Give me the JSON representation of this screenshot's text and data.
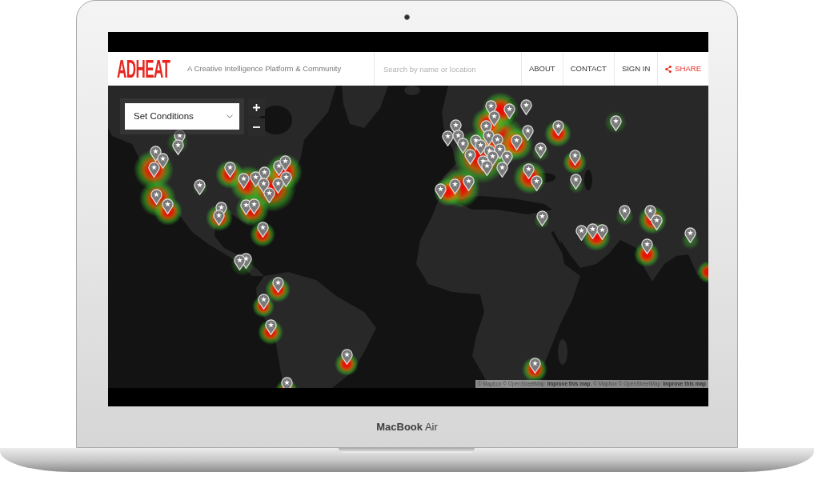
{
  "device": {
    "label": "**MacBook** Air"
  },
  "header": {
    "logo": "ADHEAT",
    "tagline": "A Creative Intelligence Platform & Community",
    "search": {
      "placeholder": "Search by name or location"
    },
    "nav": [
      {
        "kind": "link",
        "label": "ABOUT"
      },
      {
        "kind": "link",
        "label": "CONTACT"
      },
      {
        "kind": "link",
        "label": "SIGN IN"
      },
      {
        "kind": "share",
        "label": "SHARE"
      }
    ]
  },
  "map": {
    "conditions": {
      "label": "Set Conditions"
    },
    "attribution": [
      {
        "kind": "text",
        "text": "© Mapbox © OpenStreetMap"
      },
      {
        "kind": "link",
        "text": "Improve this map"
      },
      {
        "kind": "text",
        "text": ", © Mapbox © OpenStreetMap"
      },
      {
        "kind": "link",
        "text": "Improve this map"
      }
    ]
  }
}
